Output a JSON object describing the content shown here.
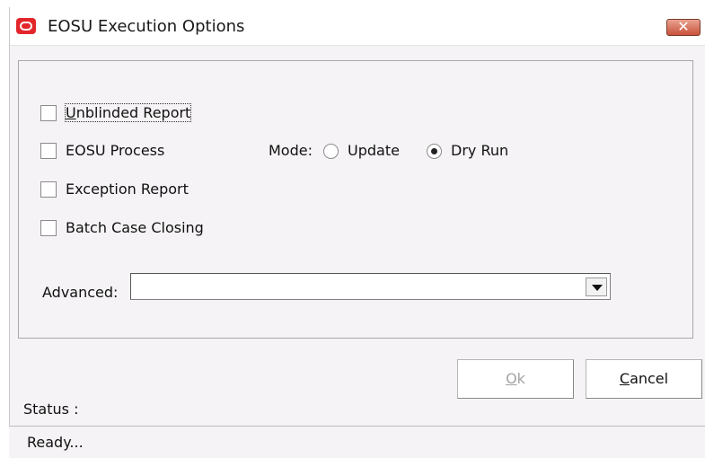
{
  "window": {
    "title": "EOSU Execution Options",
    "close_label": "✕"
  },
  "options": {
    "unblinded_report": {
      "label_access": "U",
      "label_rest": "nblinded Report",
      "checked": false
    },
    "eosu_process": {
      "label": "EOSU Process",
      "checked": false
    },
    "exception_report": {
      "label": "Exception Report",
      "checked": false
    },
    "batch_case_closing": {
      "label": "Batch Case Closing",
      "checked": false
    }
  },
  "mode": {
    "label": "Mode:",
    "update": {
      "label": "Update",
      "selected": false
    },
    "dry_run": {
      "label": "Dry Run",
      "selected": true
    }
  },
  "advanced": {
    "label": "Advanced:",
    "value": ""
  },
  "buttons": {
    "ok_access": "O",
    "ok_rest": "k",
    "cancel_access": "C",
    "cancel_rest": "ancel"
  },
  "status": {
    "label": "Status :",
    "text": "Ready..."
  },
  "colors": {
    "close_button": "#d05a43",
    "app_icon": "#e3262a"
  }
}
